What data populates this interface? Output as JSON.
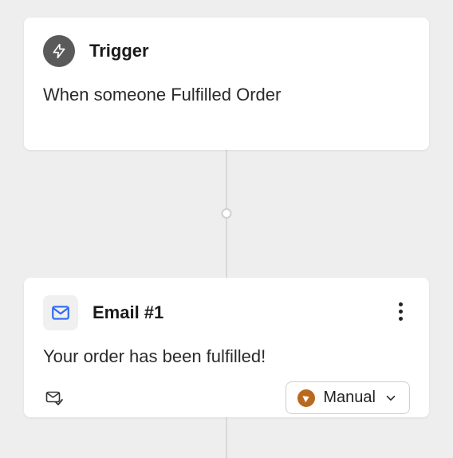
{
  "trigger": {
    "title": "Trigger",
    "description": "When someone Fulfilled Order"
  },
  "email": {
    "title": "Email #1",
    "description": "Your order has been fulfilled!",
    "mode_label": "Manual"
  },
  "colors": {
    "accent": "#2e6bf0",
    "manual_badge": "#b8691f"
  }
}
